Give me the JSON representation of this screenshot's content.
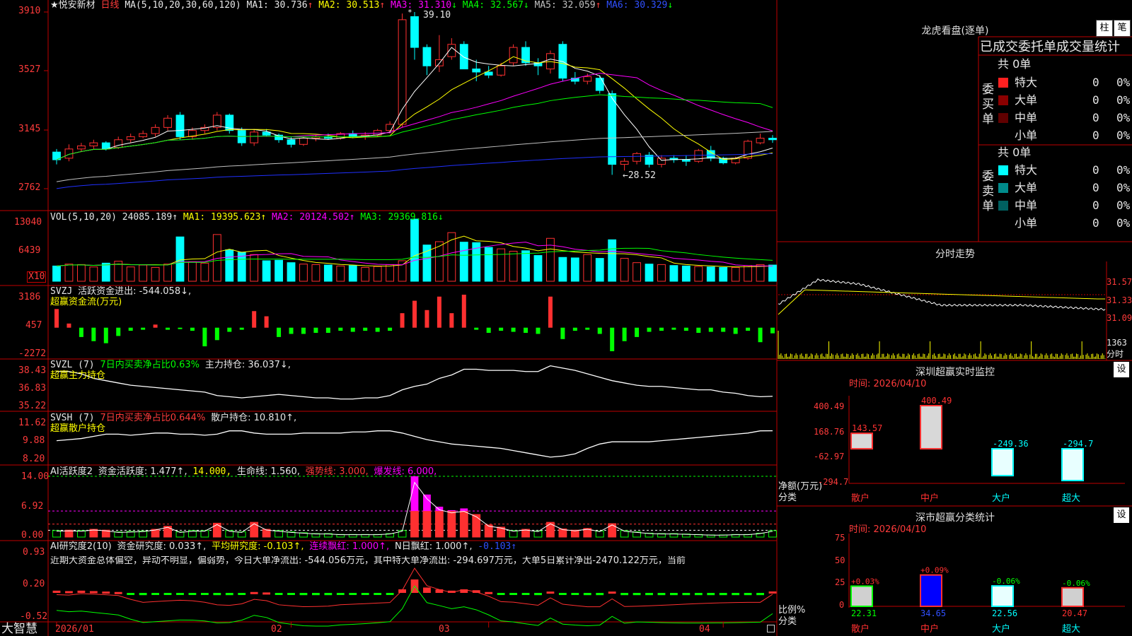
{
  "stock": {
    "name": "★悦安新材",
    "period": "日线"
  },
  "colors": {
    "up": "#ff3030",
    "down": "#00ffff",
    "ma1": "#ffffff",
    "ma2": "#ffff00",
    "ma3": "#ff00ff",
    "ma4": "#00ff00",
    "ma5": "#c0c0c0",
    "ma6": "#2030ff",
    "grid": "#c00000"
  },
  "price_panel": {
    "ma_label": "MA(5,10,20,30,60,120)",
    "ma_items": [
      {
        "label": "MA1: 30.736",
        "arrow": "↑"
      },
      {
        "label": "MA2: 30.513",
        "arrow": "↑"
      },
      {
        "label": "MA3: 31.310",
        "arrow": "↓"
      },
      {
        "label": "MA4: 32.567",
        "arrow": "↓"
      },
      {
        "label": "MA5: 32.059",
        "arrow": "↑"
      },
      {
        "label": "MA6: 30.329",
        "arrow": "↓"
      }
    ],
    "y_ticks": [
      "3910",
      "3527",
      "3145",
      "2762"
    ],
    "high_label": "39.10",
    "low_label": "←28.52"
  },
  "vol_panel": {
    "label": "VOL(5,10,20)",
    "value": "24085.189↑",
    "ma_items": [
      "MA1: 19395.623↑",
      "MA2: 20124.502↑",
      "MA3: 29369.816↓"
    ],
    "y_ticks": [
      "13040",
      "6439"
    ],
    "unit": "X10"
  },
  "svzj_panel": {
    "label": "SVZJ",
    "desc": "活跃资金进出: -544.058↓,",
    "sub": "超赢资金流(万元)",
    "y_ticks": [
      "3186",
      "457",
      "-2272"
    ]
  },
  "svzl_panel": {
    "label": "SVZL (7)",
    "desc1": "7日内买卖净占比0.63%",
    "desc2": "主力持仓: 36.037↓,",
    "sub": "超赢主力持仓",
    "y_ticks": [
      "38.43",
      "36.83",
      "35.22"
    ]
  },
  "svsh_panel": {
    "label": "SVSH (7)",
    "desc1": "7日内买卖净占比0.644%",
    "desc2": "散户持仓: 10.810↑,",
    "sub": "超赢散户持仓",
    "y_ticks": [
      "11.62",
      "9.88",
      "8.20"
    ]
  },
  "ai_active_panel": {
    "label": "AI活跃度2",
    "items": [
      {
        "text": "资金活跃度: 1.477↑,",
        "cls": "wht"
      },
      {
        "text": "14.000,",
        "cls": "yel"
      },
      {
        "text": "生命线: 1.560,",
        "cls": "wht"
      },
      {
        "text": "强势线: 3.000,",
        "cls": "red"
      },
      {
        "text": "爆发线: 6.000,",
        "cls": "mag"
      }
    ],
    "y_ticks": [
      "14.00",
      "6.92",
      "0.00"
    ]
  },
  "ai_research_panel": {
    "label": "AI研究度2(10)",
    "items": [
      {
        "text": "资金研究度: 0.033↑,",
        "cls": "wht"
      },
      {
        "text": "平均研究度: -0.103↑,",
        "cls": "yel"
      },
      {
        "text": "连续飘红: 1.000↑,",
        "cls": "mag"
      },
      {
        "text": "N日飘红: 1.000↑,",
        "cls": "wht"
      },
      {
        "text": "-0.103↑",
        "cls": "blu"
      }
    ],
    "comment": "近期大资金总体偏空，异动不明显，偏弱势，今日大单净流出: -544.056万元，其中特大单净流出: -294.697万元，大单5日累计净出-2470.122万元，当前",
    "y_ticks": [
      "0.93",
      "0.20",
      "-0.52"
    ]
  },
  "x_axis": {
    "labels": [
      "2026/01",
      "02",
      "03",
      "04"
    ],
    "brand": "大智慧"
  },
  "right_panel": {
    "dragon_title": "龙虎看盘(逐单)",
    "btn_column": "柱",
    "btn_stroke": "笔",
    "tabs_heading": "已成交委托单成交量统计",
    "buy": {
      "side_label": "委买单",
      "total": "共 0单",
      "rows": [
        {
          "label": "特大",
          "count": "0",
          "pct": "0%",
          "color": "#ff2020"
        },
        {
          "label": "大单",
          "count": "0",
          "pct": "0%",
          "color": "#8b0000"
        },
        {
          "label": "中单",
          "count": "0",
          "pct": "0%",
          "color": "#600000"
        },
        {
          "label": "小单",
          "count": "0",
          "pct": "0%",
          "color": "#000000"
        }
      ]
    },
    "sell": {
      "side_label": "委卖单",
      "total": "共 0单",
      "rows": [
        {
          "label": "特大",
          "count": "0",
          "pct": "0%",
          "color": "#00ffff"
        },
        {
          "label": "大单",
          "count": "0",
          "pct": "0%",
          "color": "#008b8b"
        },
        {
          "label": "中单",
          "count": "0",
          "pct": "0%",
          "color": "#006060"
        },
        {
          "label": "小单",
          "count": "0",
          "pct": "0%",
          "color": "#000000"
        }
      ]
    },
    "intraday": {
      "title": "分时走势",
      "price_ticks": [
        "31.57",
        "31.33",
        "31.09"
      ],
      "vol_tick": "1363",
      "vol_label": "分时"
    },
    "monitor": {
      "title": "深圳超赢实时监控",
      "btn": "设",
      "time": "时间: 2026/04/10",
      "ylabel": "净额(万元)",
      "xlabel": "分类",
      "y_ticks": [
        "400.49",
        "168.76",
        "-62.97",
        "-294.7"
      ],
      "categories": [
        "散户",
        "中户",
        "大户",
        "超大"
      ],
      "values": [
        143.57,
        400.49,
        -249.36,
        -294.7
      ],
      "value_labels": [
        "143.57",
        "400.49",
        "-249.36",
        "-294.7"
      ]
    },
    "stats": {
      "title": "深市超赢分类统计",
      "btn": "设",
      "time": "时间: 2026/04/10",
      "ylabel": "比例%",
      "xlabel": "分类",
      "y_ticks": [
        "75",
        "50",
        "25",
        "0"
      ],
      "categories": [
        "散户",
        "中户",
        "大户",
        "超大"
      ],
      "values": [
        22.31,
        34.65,
        22.56,
        20.47
      ],
      "value_labels": [
        "22.31",
        "34.65",
        "22.56",
        "20.47"
      ],
      "change_labels": [
        "+0.03%",
        "+0.09%",
        "-0.06%",
        "-0.06%"
      ]
    }
  },
  "chart_data": [
    {
      "type": "candlestick",
      "title": "★悦安新材 日线",
      "ylim": [
        27.62,
        39.1
      ],
      "ohlc": [
        [
          30.0,
          30.2,
          29.2,
          29.5
        ],
        [
          29.6,
          30.5,
          29.4,
          30.2
        ],
        [
          30.2,
          30.6,
          30.0,
          30.4
        ],
        [
          30.4,
          30.8,
          30.2,
          30.6
        ],
        [
          30.6,
          30.7,
          30.1,
          30.2
        ],
        [
          30.3,
          31.0,
          30.2,
          30.8
        ],
        [
          30.8,
          31.2,
          30.6,
          31.0
        ],
        [
          31.0,
          31.4,
          30.9,
          31.2
        ],
        [
          31.2,
          31.8,
          31.0,
          31.6
        ],
        [
          31.6,
          32.4,
          31.4,
          32.2
        ],
        [
          32.4,
          32.6,
          30.8,
          31.0
        ],
        [
          31.0,
          31.6,
          30.8,
          31.4
        ],
        [
          31.4,
          31.8,
          31.2,
          31.6
        ],
        [
          31.6,
          32.6,
          31.4,
          32.4
        ],
        [
          32.4,
          32.5,
          31.2,
          31.4
        ],
        [
          31.4,
          31.6,
          30.4,
          30.6
        ],
        [
          30.6,
          31.5,
          30.4,
          31.3
        ],
        [
          31.3,
          31.5,
          31.0,
          31.1
        ],
        [
          31.1,
          31.2,
          30.6,
          30.8
        ],
        [
          30.8,
          31.0,
          30.3,
          30.5
        ],
        [
          30.5,
          31.0,
          30.4,
          30.9
        ],
        [
          30.9,
          31.1,
          30.7,
          31.0
        ],
        [
          31.0,
          31.2,
          30.8,
          30.9
        ],
        [
          30.9,
          31.3,
          30.8,
          31.2
        ],
        [
          31.2,
          31.4,
          30.9,
          31.0
        ],
        [
          31.0,
          31.3,
          30.8,
          31.1
        ],
        [
          31.1,
          31.5,
          31.0,
          31.4
        ],
        [
          31.4,
          32.0,
          31.2,
          31.8
        ],
        [
          31.8,
          39.0,
          31.6,
          38.6
        ],
        [
          38.8,
          39.1,
          36.0,
          36.8
        ],
        [
          36.8,
          37.0,
          35.0,
          35.6
        ],
        [
          35.6,
          37.6,
          35.2,
          36.0
        ],
        [
          36.2,
          37.4,
          36.0,
          37.0
        ],
        [
          37.0,
          37.2,
          35.4,
          35.4
        ],
        [
          35.4,
          36.0,
          34.6,
          35.2
        ],
        [
          35.2,
          35.6,
          34.8,
          35.0
        ],
        [
          35.0,
          35.8,
          34.9,
          35.6
        ],
        [
          35.8,
          37.0,
          35.6,
          36.8
        ],
        [
          36.8,
          37.2,
          35.6,
          35.8
        ],
        [
          35.8,
          36.1,
          35.0,
          35.6
        ],
        [
          35.4,
          36.6,
          35.1,
          36.4
        ],
        [
          37.0,
          37.2,
          34.6,
          34.8
        ],
        [
          34.8,
          35.2,
          34.4,
          34.6
        ],
        [
          34.6,
          35.1,
          34.4,
          34.9
        ],
        [
          34.8,
          35.0,
          33.8,
          34.0
        ],
        [
          33.8,
          34.0,
          28.52,
          29.2
        ],
        [
          29.2,
          29.6,
          28.8,
          29.4
        ],
        [
          29.4,
          30.0,
          29.2,
          29.9
        ],
        [
          29.8,
          30.0,
          29.0,
          29.2
        ],
        [
          29.2,
          29.8,
          29.0,
          29.6
        ],
        [
          29.6,
          29.8,
          29.3,
          29.5
        ],
        [
          29.5,
          29.8,
          29.1,
          29.4
        ],
        [
          29.4,
          30.2,
          29.3,
          30.1
        ],
        [
          30.1,
          30.4,
          29.4,
          29.6
        ],
        [
          29.6,
          29.7,
          29.2,
          29.3
        ],
        [
          29.3,
          29.7,
          29.2,
          29.6
        ],
        [
          29.6,
          30.8,
          29.5,
          30.7
        ],
        [
          30.6,
          31.2,
          30.5,
          30.9
        ],
        [
          30.9,
          31.1,
          30.6,
          30.8
        ]
      ]
    },
    {
      "type": "bar",
      "title": "VOL(5,10,20)",
      "values": [
        3200,
        3600,
        3500,
        3000,
        3800,
        4200,
        3000,
        3400,
        2900,
        3600,
        9300,
        4100,
        3800,
        9800,
        6600,
        6100,
        5600,
        4300,
        4400,
        3900,
        3600,
        3500,
        3400,
        3200,
        3300,
        2900,
        3100,
        3500,
        4300,
        13040,
        7600,
        8300,
        10200,
        8200,
        8100,
        7100,
        6800,
        6300,
        6400,
        5400,
        9000,
        5000,
        4900,
        5600,
        4800,
        8700,
        4800,
        3900,
        3600,
        3500,
        3300,
        3200,
        3100,
        3000,
        2900,
        2900,
        3300,
        3500,
        3400
      ]
    },
    {
      "type": "bar",
      "title": "SVZJ 活跃资金进出",
      "values": [
        1800,
        400,
        -900,
        -1300,
        -1500,
        -800,
        -300,
        -200,
        300,
        -200,
        -100,
        -300,
        -1800,
        -1200,
        -400,
        -200,
        1600,
        1100,
        -900,
        -600,
        -600,
        -500,
        -500,
        -300,
        -400,
        -300,
        -400,
        -300,
        1400,
        2600,
        1700,
        3000,
        1400,
        3186,
        -200,
        -500,
        -300,
        -400,
        -500,
        -600,
        3000,
        -1100,
        -300,
        -200,
        -600,
        -2272,
        -1300,
        -900,
        -400,
        -300,
        -200,
        -300,
        -500,
        -400,
        -400,
        -600,
        -300,
        -1400,
        -544
      ]
    },
    {
      "type": "line",
      "title": "SVZL 主力持仓",
      "values": [
        38.2,
        38.2,
        38.0,
        37.6,
        37.4,
        37.2,
        37.0,
        36.9,
        36.8,
        36.7,
        36.6,
        36.5,
        36.4,
        36.1,
        36.0,
        35.9,
        36.0,
        36.1,
        36.2,
        36.1,
        36.0,
        35.9,
        35.9,
        35.8,
        35.8,
        35.9,
        35.9,
        36.1,
        36.6,
        36.9,
        37.1,
        37.6,
        37.9,
        38.4,
        38.4,
        38.3,
        38.3,
        38.3,
        38.2,
        38.2,
        38.7,
        38.5,
        38.3,
        38.0,
        37.7,
        37.4,
        37.2,
        37.0,
        36.9,
        36.9,
        36.8,
        36.7,
        36.6,
        36.6,
        36.4,
        36.3,
        36.1,
        36.0,
        36.04
      ]
    },
    {
      "type": "line",
      "title": "SVSH 散户持仓",
      "values": [
        9.9,
        10.0,
        10.1,
        10.3,
        10.5,
        10.5,
        10.4,
        10.5,
        10.6,
        10.6,
        10.5,
        10.5,
        10.4,
        10.5,
        10.8,
        10.8,
        10.6,
        10.5,
        10.5,
        10.5,
        10.6,
        10.6,
        10.6,
        10.6,
        10.7,
        10.7,
        10.8,
        10.8,
        10.6,
        10.3,
        10.0,
        9.8,
        9.6,
        9.5,
        9.4,
        9.3,
        9.2,
        9.0,
        8.8,
        8.6,
        8.4,
        8.5,
        8.7,
        9.2,
        9.6,
        9.8,
        9.8,
        9.8,
        9.8,
        9.9,
        10.0,
        10.1,
        10.2,
        10.3,
        10.4,
        10.5,
        10.6,
        10.8,
        10.81
      ]
    },
    {
      "type": "bar",
      "title": "AI活跃度2",
      "values": [
        1.5,
        1.6,
        1.5,
        1.8,
        1.6,
        1.2,
        1.3,
        1.4,
        1.8,
        2.5,
        1.2,
        1.5,
        1.5,
        3.2,
        1.5,
        1.2,
        3.4,
        1.8,
        1.5,
        1.2,
        1.0,
        0.8,
        0.8,
        0.6,
        0.6,
        0.6,
        0.6,
        0.8,
        1.5,
        14.0,
        9.8,
        7.0,
        6.2,
        6.6,
        5.2,
        2.8,
        2.3,
        1.5,
        1.8,
        1.4,
        3.4,
        1.9,
        1.6,
        2.0,
        1.4,
        3.1,
        1.5,
        1.2,
        0.9,
        0.8,
        0.8,
        0.7,
        0.6,
        0.5,
        0.5,
        0.6,
        0.6,
        0.9,
        1.48
      ]
    },
    {
      "type": "bar",
      "title": "AI研究度2(10)",
      "values": [
        0.05,
        0.04,
        0.05,
        0.04,
        0.03,
        0.02,
        -0.02,
        -0.05,
        -0.04,
        -0.03,
        -0.02,
        -0.02,
        -0.03,
        -0.05,
        -0.05,
        -0.03,
        0.02,
        0.01,
        -0.03,
        -0.04,
        -0.05,
        -0.05,
        -0.05,
        -0.04,
        -0.04,
        -0.04,
        -0.04,
        -0.04,
        0.08,
        0.3,
        0.12,
        0.08,
        0.05,
        0.08,
        0.06,
        0.02,
        -0.03,
        -0.03,
        -0.04,
        -0.05,
        0.03,
        -0.03,
        -0.04,
        -0.05,
        -0.05,
        0.03,
        -0.05,
        -0.05,
        -0.05,
        -0.05,
        -0.05,
        -0.05,
        -0.05,
        -0.05,
        -0.05,
        -0.05,
        -0.05,
        -0.05,
        0.033
      ]
    }
  ]
}
